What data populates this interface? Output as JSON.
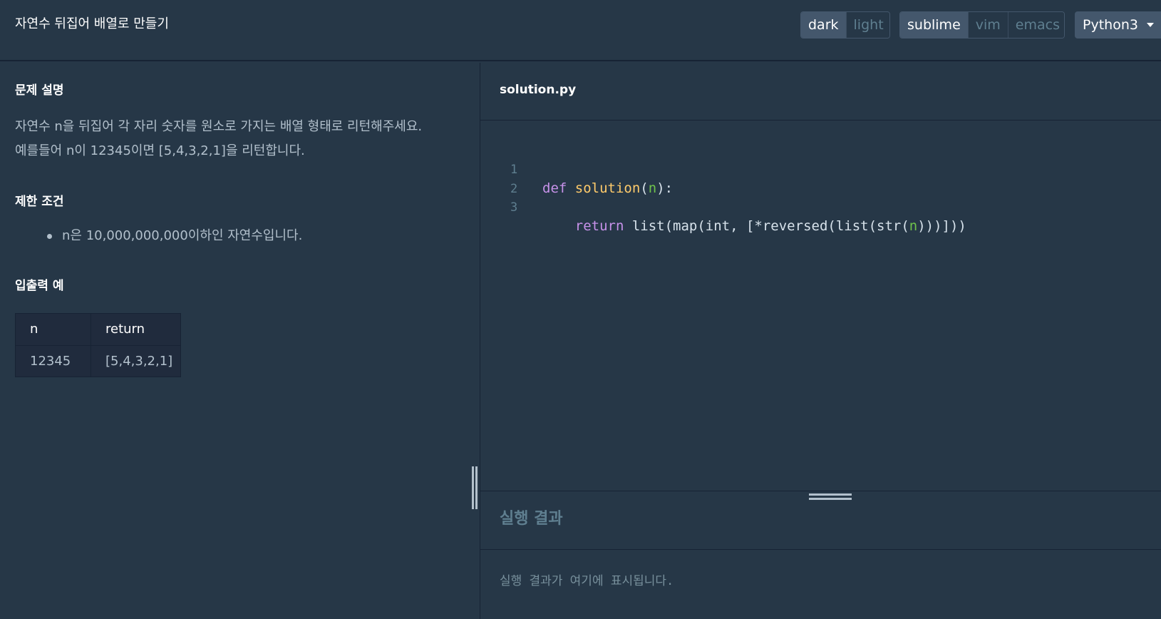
{
  "header": {
    "title": "자연수 뒤집어 배열로 만들기",
    "theme_options": [
      "dark",
      "light"
    ],
    "theme_selected": "dark",
    "keymap_options": [
      "sublime",
      "vim",
      "emacs"
    ],
    "keymap_selected": "sublime",
    "language": "Python3"
  },
  "problem": {
    "section_description": "문제 설명",
    "description_lines": [
      "자연수 n을 뒤집어 각 자리 숫자를 원소로 가지는 배열 형태로 리턴해주세요.",
      "예를들어 n이 12345이면 [5,4,3,2,1]을 리턴합니다."
    ],
    "section_constraints": "제한 조건",
    "constraints": [
      "n은 10,000,000,000이하인 자연수입니다."
    ],
    "section_examples": "입출력 예",
    "examples_table": {
      "headers": [
        "n",
        "return"
      ],
      "rows": [
        [
          "12345",
          "[5,4,3,2,1]"
        ]
      ]
    }
  },
  "editor": {
    "file_name": "solution.py",
    "line_numbers": [
      "1",
      "2",
      "3"
    ],
    "line1": {
      "kw": "def",
      "fn": "solution",
      "open": "(",
      "arg": "n",
      "close": "):"
    },
    "line3": {
      "indent": "    ",
      "kw": "return",
      "pre": " list(map(int, [*reversed(list(str(",
      "arg": "n",
      "post": ")))]))"
    }
  },
  "result": {
    "title": "실행 결과",
    "placeholder": "실행 결과가 여기에 표시됩니다."
  },
  "colors": {
    "background": "#263747",
    "border": "#172334",
    "active_segment": "#44576c",
    "keyword": "#c792ea",
    "function": "#ffcb6b",
    "argument": "#6fc34b"
  }
}
